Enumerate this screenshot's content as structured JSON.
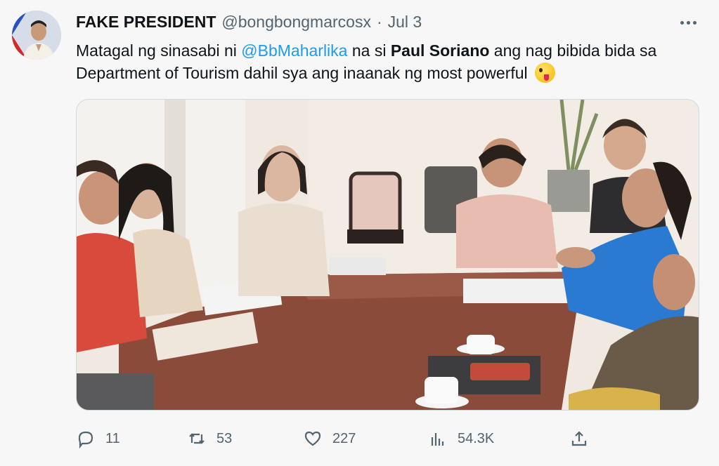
{
  "tweet": {
    "author_name": "FAKE PRESIDENT",
    "handle": "@bongbongmarcosx",
    "separator": "·",
    "date": "Jul 3",
    "text_1": "Matagal ng sinasabi ni ",
    "mention": "@BbMaharlika",
    "text_2": " na si ",
    "bold_name": "Paul Soriano",
    "text_3": " ang nag bibida bida sa Department of Tourism dahil sya ang inaanak ng most powerful",
    "emoji": "winking-face-with-tongue"
  },
  "actions": {
    "replies": "11",
    "retweets": "53",
    "likes": "227",
    "views": "54.3K"
  },
  "icons": {
    "reply": "speech-bubble-icon",
    "retweet": "retweet-arrows-icon",
    "like": "heart-icon",
    "views": "bar-chart-icon",
    "share": "upload-arrow-icon",
    "more": "ellipsis-icon"
  },
  "colors": {
    "link": "#1d9bf0",
    "secondary_text": "#536471",
    "background": "#f7f7f8"
  }
}
